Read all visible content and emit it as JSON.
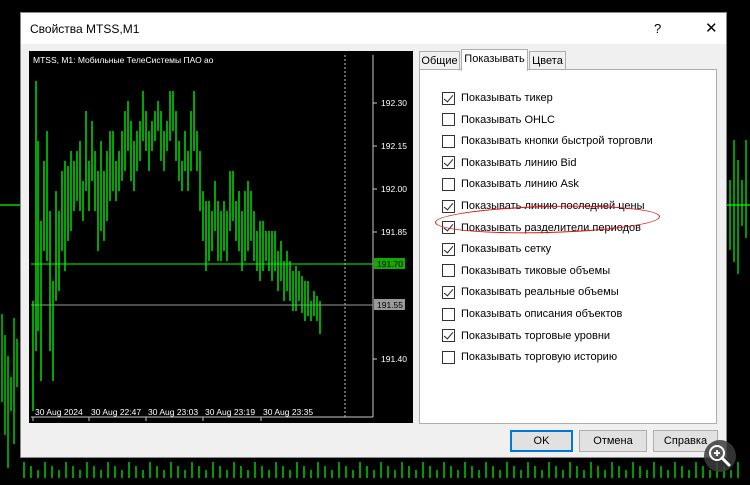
{
  "dialog": {
    "title": "Свойства MTSS,M1",
    "help_label": "?",
    "close_label": "✕"
  },
  "chart": {
    "header": "MTSS, M1: Мобильные ТелеСистемы ПАО ао",
    "price_labels": [
      "192.30",
      "192.15",
      "192.00",
      "191.85",
      "191.40"
    ],
    "bid_label": "191.70",
    "last_label": "191.55",
    "time_labels": [
      "30 Aug 2024",
      "30 Aug 22:47",
      "30 Aug 23:03",
      "30 Aug 23:19",
      "30 Aug 23:35"
    ],
    "colors": {
      "bars": "#00ff00",
      "bid_tag": "#16a800",
      "last_tag": "#9a9a9a",
      "grid": "#7a7a7a"
    }
  },
  "tabs": [
    {
      "label": "Общие",
      "active": false
    },
    {
      "label": "Показывать",
      "active": true
    },
    {
      "label": "Цвета",
      "active": false
    }
  ],
  "options": [
    {
      "label": "Показывать тикер",
      "checked": true
    },
    {
      "label": "Показывать OHLC",
      "checked": false
    },
    {
      "label": "Показывать кнопки быстрой торговли",
      "checked": false
    },
    {
      "label": "Показывать линию Bid",
      "checked": true
    },
    {
      "label": "Показывать линию Ask",
      "checked": false
    },
    {
      "label": "Показывать линию последней цены",
      "checked": true
    },
    {
      "label": "Показывать разделители периодов",
      "checked": true
    },
    {
      "label": "Показывать сетку",
      "checked": true
    },
    {
      "label": "Показывать тиковые объемы",
      "checked": false
    },
    {
      "label": "Показывать реальные объемы",
      "checked": true
    },
    {
      "label": "Показывать описания объектов",
      "checked": false
    },
    {
      "label": "Показывать торговые уровни",
      "checked": true
    },
    {
      "label": "Показывать торговую историю",
      "checked": false
    }
  ],
  "buttons": {
    "ok": "OK",
    "cancel": "Отмена",
    "help": "Справка"
  },
  "icons": {
    "zoom": "zoom-in-icon"
  }
}
